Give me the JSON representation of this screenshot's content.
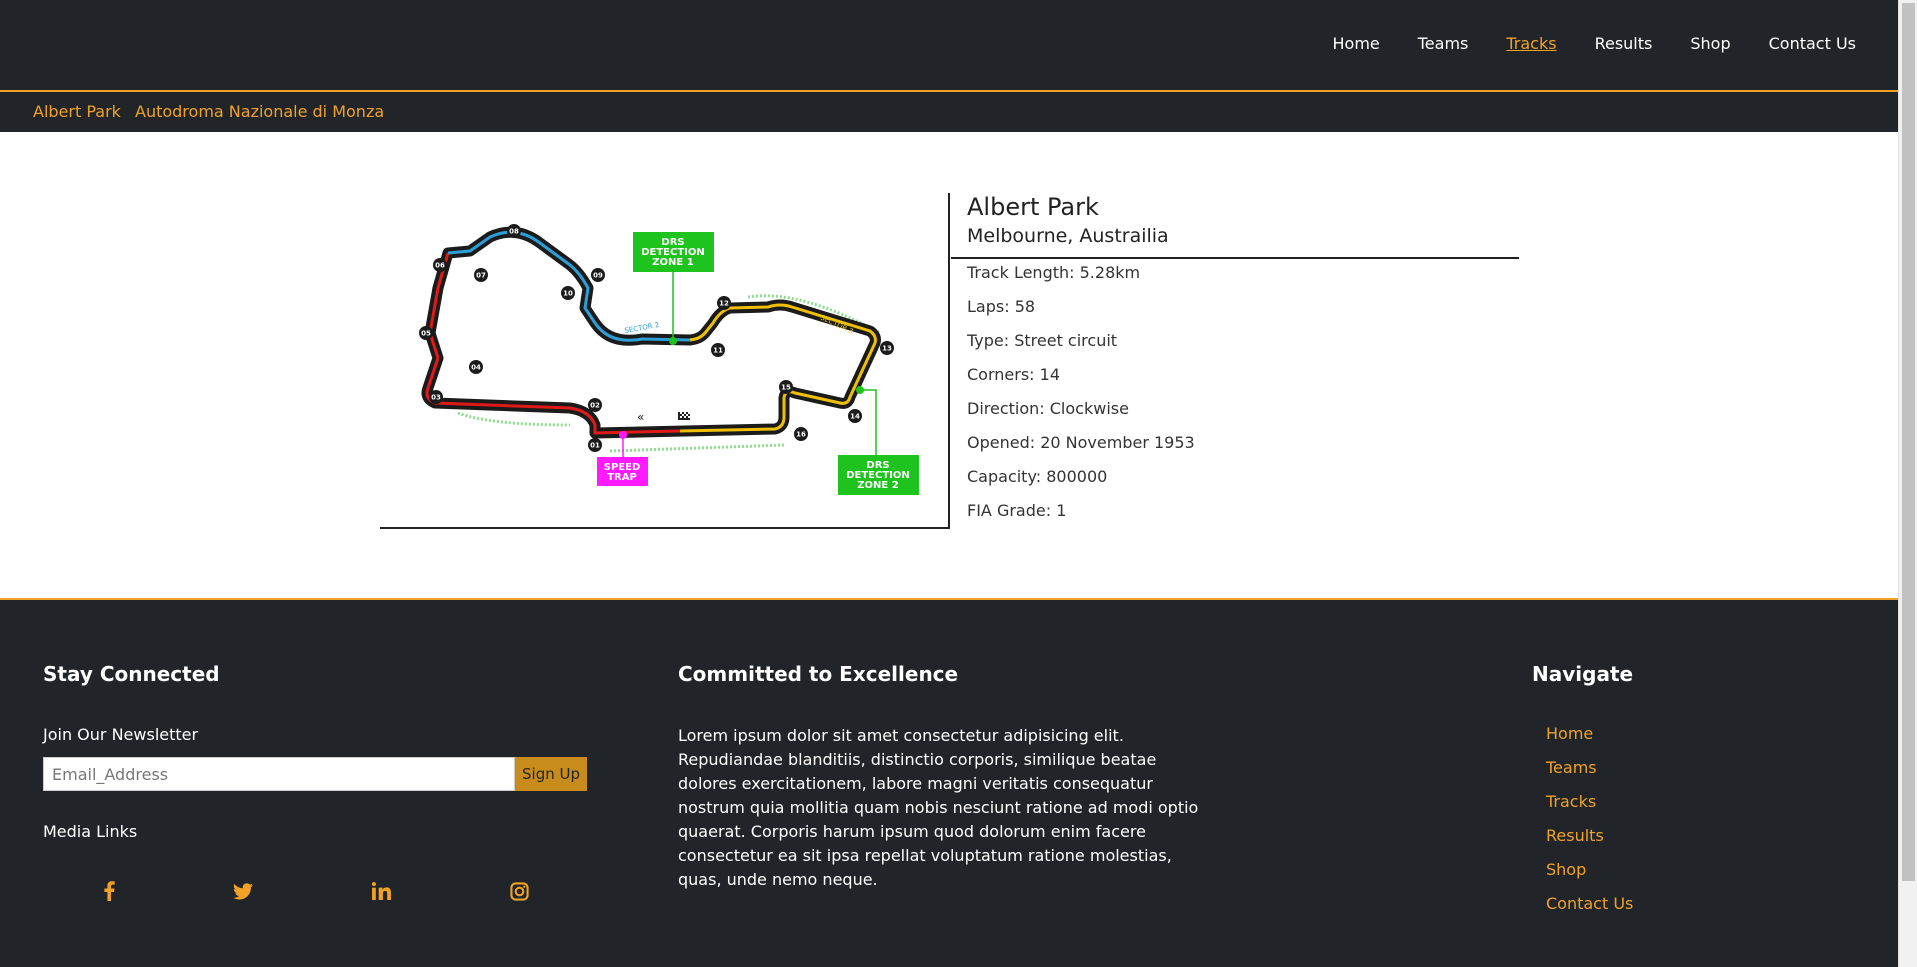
{
  "nav": {
    "items": [
      "Home",
      "Teams",
      "Tracks",
      "Results",
      "Shop",
      "Contact Us"
    ],
    "active": "Tracks"
  },
  "subnav": {
    "items": [
      "Albert Park",
      "Autodroma Nazionale di Monza"
    ]
  },
  "track_map": {
    "drs_zone_1": [
      "DRS",
      "DETECTION",
      "ZONE 1"
    ],
    "drs_zone_2": [
      "DRS",
      "DETECTION",
      "ZONE 2"
    ],
    "speed_trap": [
      "SPEED",
      "TRAP"
    ],
    "sector_2": "SECTOR 2",
    "sector_3": "SECTOR 3",
    "turns": [
      "01",
      "02",
      "03",
      "04",
      "05",
      "06",
      "07",
      "08",
      "09",
      "10",
      "11",
      "12",
      "13",
      "14",
      "15",
      "16"
    ]
  },
  "track": {
    "name": "Albert Park",
    "location": "Melbourne, Austrailia",
    "rows": [
      "Track Length: 5.28km",
      "Laps: 58",
      "Type: Street circuit",
      "Corners: 14",
      "Direction: Clockwise",
      "Opened: 20 November 1953",
      "Capacity: 800000",
      "FIA Grade: 1"
    ]
  },
  "footer": {
    "stay_connected": "Stay Connected",
    "newsletter_label": "Join Our Newsletter",
    "email_placeholder": "Email_Address",
    "signup_label": "Sign Up",
    "media_links": "Media Links",
    "social_icons": [
      "facebook-icon",
      "twitter-icon",
      "linkedin-icon",
      "instagram-icon"
    ],
    "committed_title": "Committed to Excellence",
    "lorem": "Lorem ipsum dolor sit amet consectetur adipisicing elit. Repudiandae blanditiis, distinctio corporis, similique beatae dolores exercitationem, labore magni veritatis consequatur nostrum quia mollitia quam nobis nesciunt ratione ad modi optio quaerat. Corporis harum ipsum quod dolorum enim facere consectetur ea sit ipsa repellat voluptatum ratione molestias, quas, unde nemo neque.",
    "navigate_title": "Navigate",
    "navigate_items": [
      "Home",
      "Teams",
      "Tracks",
      "Results",
      "Shop",
      "Contact Us"
    ]
  },
  "colors": {
    "dark": "#212529",
    "accent": "#f0a226",
    "drs_green": "#1ec31e",
    "speed_trap_magenta": "#ff1aff"
  }
}
